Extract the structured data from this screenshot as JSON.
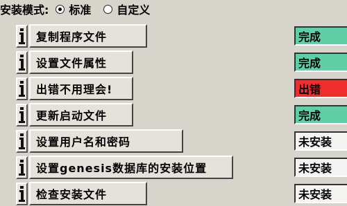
{
  "install_mode": {
    "label": "安装模式:",
    "options": [
      {
        "label": "标准",
        "selected": true
      },
      {
        "label": "自定义",
        "selected": false
      }
    ]
  },
  "steps": [
    {
      "label": "复制程序文件",
      "status": "完成",
      "status_color": "#5fcfa8"
    },
    {
      "label": "设置文件属性",
      "status": "完成",
      "status_color": "#5fcfa8"
    },
    {
      "label": "出错不用理会!",
      "status": "出错",
      "status_color": "#ee2d2d"
    },
    {
      "label": "更新启动文件",
      "status": "完成",
      "status_color": "#5fcfa8"
    },
    {
      "label": "设置用户名和密码",
      "status": "未安装",
      "status_color": "#f4f4f2"
    },
    {
      "label": "设置genesis数据库的安装位置",
      "status": "未安装",
      "status_color": "#f4f4f2"
    },
    {
      "label": "检查安装文件",
      "status": "未安装",
      "status_color": "#f4f4f2"
    }
  ],
  "info_icon": "info-i-icon"
}
